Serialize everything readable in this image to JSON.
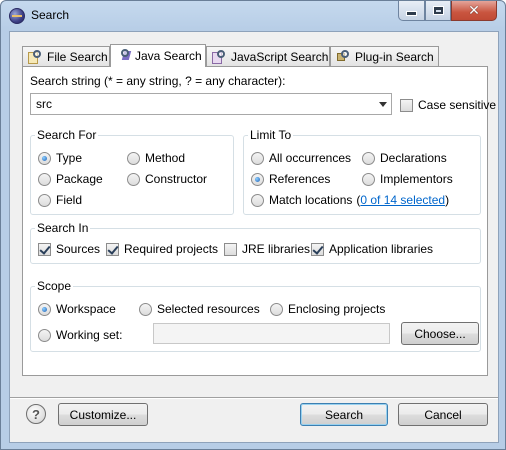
{
  "window": {
    "title": "Search"
  },
  "tabs": [
    {
      "label": "File Search",
      "icon": "file-search-icon"
    },
    {
      "label": "Java Search",
      "icon": "java-search-icon",
      "active": true
    },
    {
      "label": "JavaScript Search",
      "icon": "javascript-search-icon"
    },
    {
      "label": "Plug-in Search",
      "icon": "plugin-search-icon"
    }
  ],
  "search": {
    "label": "Search string (* = any string, ? = any character):",
    "value": "src",
    "case_sensitive_label": "Case sensitive",
    "case_sensitive": false
  },
  "search_for": {
    "title": "Search For",
    "options": [
      {
        "label": "Type",
        "selected": true
      },
      {
        "label": "Package",
        "selected": false
      },
      {
        "label": "Field",
        "selected": false
      },
      {
        "label": "Method",
        "selected": false
      },
      {
        "label": "Constructor",
        "selected": false
      }
    ]
  },
  "limit_to": {
    "title": "Limit To",
    "options": [
      {
        "label": "All occurrences",
        "selected": false
      },
      {
        "label": "References",
        "selected": true
      },
      {
        "label": "Match locations",
        "selected": false
      },
      {
        "label": "Declarations",
        "selected": false
      },
      {
        "label": "Implementors",
        "selected": false
      }
    ],
    "match_locations_link": "0 of 14 selected",
    "paren_open": "(",
    "paren_close": ")"
  },
  "search_in": {
    "title": "Search In",
    "options": [
      {
        "label": "Sources",
        "checked": true
      },
      {
        "label": "Required projects",
        "checked": true
      },
      {
        "label": "JRE libraries",
        "checked": false
      },
      {
        "label": "Application libraries",
        "checked": true
      }
    ]
  },
  "scope": {
    "title": "Scope",
    "options": [
      {
        "label": "Workspace",
        "selected": true
      },
      {
        "label": "Selected resources",
        "selected": false
      },
      {
        "label": "Enclosing projects",
        "selected": false
      },
      {
        "label": "Working set:",
        "selected": false
      }
    ],
    "working_set_value": "",
    "choose_label": "Choose..."
  },
  "footer": {
    "help_symbol": "?",
    "customize_label": "Customize...",
    "search_label": "Search",
    "cancel_label": "Cancel"
  }
}
